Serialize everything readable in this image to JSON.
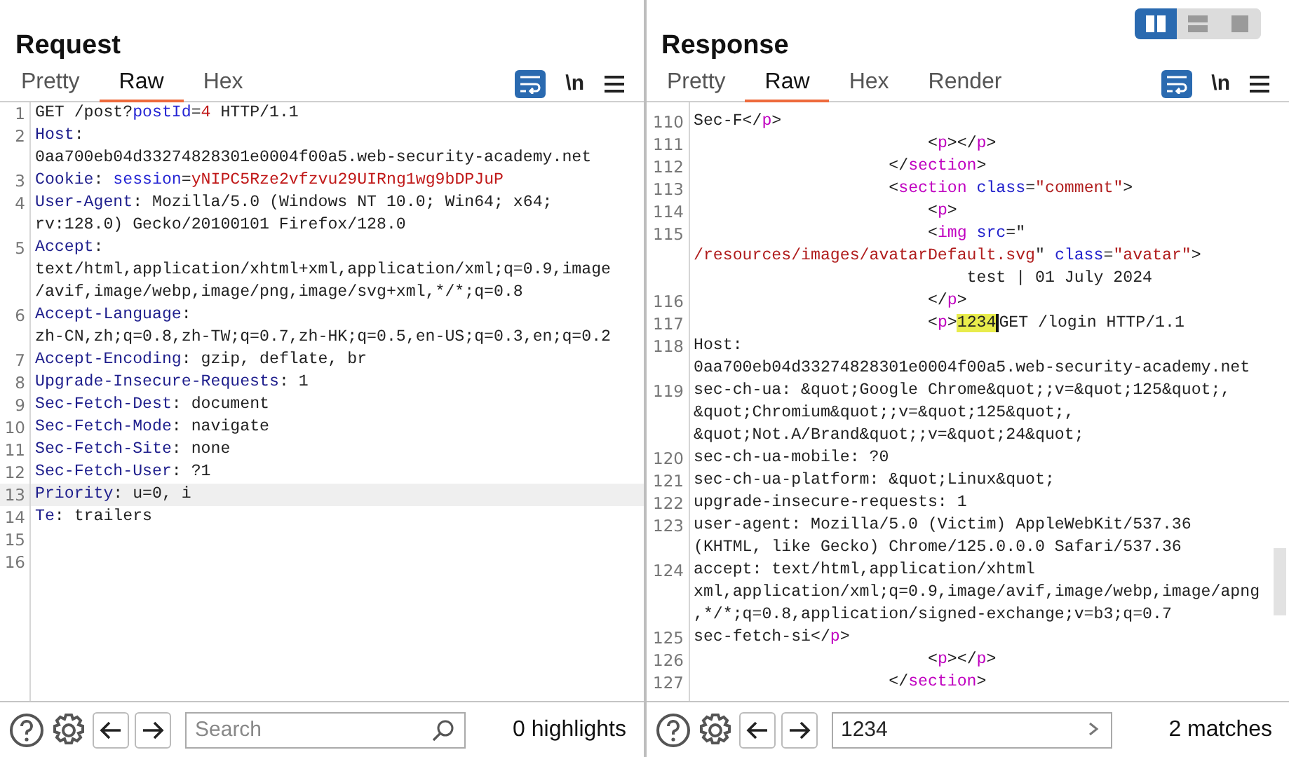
{
  "layout_buttons": [
    {
      "kind": "columns",
      "selected": true
    },
    {
      "kind": "rows",
      "selected": false
    },
    {
      "kind": "single",
      "selected": false
    }
  ],
  "panes": [
    {
      "title": "Request",
      "tabs": [
        {
          "label": "Pretty",
          "selected": false
        },
        {
          "label": "Raw",
          "selected": true
        },
        {
          "label": "Hex",
          "selected": false
        }
      ],
      "wrap_on": true,
      "newline_label": "\\n",
      "rows": [
        {
          "number": "1",
          "current": false,
          "segments": [
            {
              "kind": "plain",
              "text": "GET /post?"
            },
            {
              "kind": "param",
              "text": "postId"
            },
            {
              "kind": "plain",
              "text": "="
            },
            {
              "kind": "value",
              "text": "4"
            },
            {
              "kind": "plain",
              "text": " HTTP/1.1"
            }
          ]
        },
        {
          "number": "2",
          "current": false,
          "segments": [
            {
              "kind": "name",
              "text": "Host"
            },
            {
              "kind": "plain",
              "text": ":"
            }
          ]
        },
        {
          "current": false,
          "segments": [
            {
              "kind": "plain",
              "text": "0aa700eb04d33274828301e0004f00a5.web-security-academy.net"
            }
          ]
        },
        {
          "number": "3",
          "current": false,
          "segments": [
            {
              "kind": "name",
              "text": "Cookie"
            },
            {
              "kind": "plain",
              "text": ": "
            },
            {
              "kind": "param",
              "text": "session"
            },
            {
              "kind": "plain",
              "text": "="
            },
            {
              "kind": "value",
              "text": "yNIPC5Rze2vfzvu29UIRng1wg9bDPJuP"
            }
          ]
        },
        {
          "number": "4",
          "current": false,
          "segments": [
            {
              "kind": "name",
              "text": "User-Agent"
            },
            {
              "kind": "plain",
              "text": ": Mozilla/5.0 (Windows NT 10.0; Win64; x64;"
            }
          ]
        },
        {
          "current": false,
          "segments": [
            {
              "kind": "plain",
              "text": "rv:128.0) Gecko/20100101 Firefox/128.0"
            }
          ]
        },
        {
          "number": "5",
          "current": false,
          "segments": [
            {
              "kind": "name",
              "text": "Accept"
            },
            {
              "kind": "plain",
              "text": ":"
            }
          ]
        },
        {
          "current": false,
          "segments": [
            {
              "kind": "plain",
              "text": "text/html,application/xhtml+xml,application/xml;q=0.9,image"
            }
          ]
        },
        {
          "current": false,
          "segments": [
            {
              "kind": "plain",
              "text": "/avif,image/webp,image/png,image/svg+xml,*/*;q=0.8"
            }
          ]
        },
        {
          "number": "6",
          "current": false,
          "segments": [
            {
              "kind": "name",
              "text": "Accept-Language"
            },
            {
              "kind": "plain",
              "text": ":"
            }
          ]
        },
        {
          "current": false,
          "segments": [
            {
              "kind": "plain",
              "text": "zh-CN,zh;q=0.8,zh-TW;q=0.7,zh-HK;q=0.5,en-US;q=0.3,en;q=0.2"
            }
          ]
        },
        {
          "number": "7",
          "current": false,
          "segments": [
            {
              "kind": "name",
              "text": "Accept-Encoding"
            },
            {
              "kind": "plain",
              "text": ": gzip, deflate, br"
            }
          ]
        },
        {
          "number": "8",
          "current": false,
          "segments": [
            {
              "kind": "name",
              "text": "Upgrade-Insecure-Requests"
            },
            {
              "kind": "plain",
              "text": ": 1"
            }
          ]
        },
        {
          "number": "9",
          "current": false,
          "segments": [
            {
              "kind": "name",
              "text": "Sec-Fetch-Dest"
            },
            {
              "kind": "plain",
              "text": ": document"
            }
          ]
        },
        {
          "number": "10",
          "current": false,
          "segments": [
            {
              "kind": "name",
              "text": "Sec-Fetch-Mode"
            },
            {
              "kind": "plain",
              "text": ": navigate"
            }
          ]
        },
        {
          "number": "11",
          "current": false,
          "segments": [
            {
              "kind": "name",
              "text": "Sec-Fetch-Site"
            },
            {
              "kind": "plain",
              "text": ": none"
            }
          ]
        },
        {
          "number": "12",
          "current": false,
          "segments": [
            {
              "kind": "name",
              "text": "Sec-Fetch-User"
            },
            {
              "kind": "plain",
              "text": ": ?1"
            }
          ]
        },
        {
          "number": "13",
          "current": true,
          "segments": [
            {
              "kind": "name",
              "text": "Priority"
            },
            {
              "kind": "plain",
              "text": ": u=0, i"
            }
          ]
        },
        {
          "number": "14",
          "current": false,
          "segments": [
            {
              "kind": "name",
              "text": "Te"
            },
            {
              "kind": "plain",
              "text": ": trailers"
            }
          ]
        },
        {
          "number": "15",
          "current": false
        },
        {
          "number": "16",
          "current": false
        }
      ],
      "search": {
        "placeholder": "Search"
      },
      "status": "0 highlights"
    },
    {
      "title": "Response",
      "tabs": [
        {
          "label": "Pretty",
          "selected": false
        },
        {
          "label": "Raw",
          "selected": true
        },
        {
          "label": "Hex",
          "selected": false
        },
        {
          "label": "Render",
          "selected": false
        }
      ],
      "wrap_on": true,
      "newline_label": "\\n",
      "rows": [
        {
          "number": "110",
          "current": false,
          "segments": [
            {
              "kind": "plain",
              "text": "Sec-F</"
            },
            {
              "kind": "tag",
              "text": "p"
            },
            {
              "kind": "plain",
              "text": ">"
            }
          ]
        },
        {
          "number": "111",
          "current": false,
          "segments": [
            {
              "kind": "plain",
              "text": "                        <"
            },
            {
              "kind": "tag",
              "text": "p"
            },
            {
              "kind": "plain",
              "text": "></"
            },
            {
              "kind": "tag",
              "text": "p"
            },
            {
              "kind": "plain",
              "text": ">"
            }
          ]
        },
        {
          "number": "112",
          "current": false,
          "segments": [
            {
              "kind": "plain",
              "text": "                    </"
            },
            {
              "kind": "tag",
              "text": "section"
            },
            {
              "kind": "plain",
              "text": ">"
            }
          ]
        },
        {
          "number": "113",
          "current": false,
          "segments": [
            {
              "kind": "plain",
              "text": "                    <"
            },
            {
              "kind": "tag",
              "text": "section"
            },
            {
              "kind": "attr",
              "text": " class"
            },
            {
              "kind": "plain",
              "text": "="
            },
            {
              "kind": "string",
              "text": "\"comment\""
            },
            {
              "kind": "plain",
              "text": ">"
            }
          ]
        },
        {
          "number": "114",
          "current": false,
          "segments": [
            {
              "kind": "plain",
              "text": "                        <"
            },
            {
              "kind": "tag",
              "text": "p"
            },
            {
              "kind": "plain",
              "text": ">"
            }
          ]
        },
        {
          "number": "115",
          "current": false,
          "segments": [
            {
              "kind": "plain",
              "text": "                        <"
            },
            {
              "kind": "tag",
              "text": "img"
            },
            {
              "kind": "attr",
              "text": " src"
            },
            {
              "kind": "plain",
              "text": "=\""
            }
          ]
        },
        {
          "current": false,
          "segments": [
            {
              "kind": "string",
              "text": "/resources/images/avatarDefault.svg"
            },
            {
              "kind": "plain",
              "text": "\" "
            },
            {
              "kind": "attr",
              "text": "class"
            },
            {
              "kind": "plain",
              "text": "="
            },
            {
              "kind": "string",
              "text": "\"avatar\""
            },
            {
              "kind": "plain",
              "text": ">"
            }
          ]
        },
        {
          "current": false,
          "segments": [
            {
              "kind": "plain",
              "text": "                            test | 01 July 2024"
            }
          ]
        },
        {
          "number": "116",
          "current": false,
          "segments": [
            {
              "kind": "plain",
              "text": "                        </"
            },
            {
              "kind": "tag",
              "text": "p"
            },
            {
              "kind": "plain",
              "text": ">"
            }
          ]
        },
        {
          "number": "117",
          "current": false,
          "segments": [
            {
              "kind": "plain",
              "text": "                        <"
            },
            {
              "kind": "tag",
              "text": "p"
            },
            {
              "kind": "plain",
              "text": ">"
            },
            {
              "kind": "match",
              "text": "1234"
            },
            {
              "kind": "plain",
              "text": "GET /login HTTP/1.1"
            }
          ]
        },
        {
          "number": "118",
          "current": false,
          "segments": [
            {
              "kind": "plain",
              "text": "Host:"
            }
          ]
        },
        {
          "current": false,
          "segments": [
            {
              "kind": "plain",
              "text": "0aa700eb04d33274828301e0004f00a5.web-security-academy.net"
            }
          ]
        },
        {
          "number": "119",
          "current": false,
          "segments": [
            {
              "kind": "plain",
              "text": "sec-ch-ua: &quot;Google Chrome&quot;;v=&quot;125&quot;,"
            }
          ]
        },
        {
          "current": false,
          "segments": [
            {
              "kind": "plain",
              "text": "&quot;Chromium&quot;;v=&quot;125&quot;,"
            }
          ]
        },
        {
          "current": false,
          "segments": [
            {
              "kind": "plain",
              "text": "&quot;Not.A/Brand&quot;;v=&quot;24&quot;"
            }
          ]
        },
        {
          "number": "120",
          "current": false,
          "segments": [
            {
              "kind": "plain",
              "text": "sec-ch-ua-mobile: ?0"
            }
          ]
        },
        {
          "number": "121",
          "current": false,
          "segments": [
            {
              "kind": "plain",
              "text": "sec-ch-ua-platform: &quot;Linux&quot;"
            }
          ]
        },
        {
          "number": "122",
          "current": false,
          "segments": [
            {
              "kind": "plain",
              "text": "upgrade-insecure-requests: 1"
            }
          ]
        },
        {
          "number": "123",
          "current": false,
          "segments": [
            {
              "kind": "plain",
              "text": "user-agent: Mozilla/5.0 (Victim) AppleWebKit/537.36"
            }
          ]
        },
        {
          "current": false,
          "segments": [
            {
              "kind": "plain",
              "text": "(KHTML, like Gecko) Chrome/125.0.0.0 Safari/537.36"
            }
          ]
        },
        {
          "number": "124",
          "current": false,
          "segments": [
            {
              "kind": "plain",
              "text": "accept: text/html,application/xhtml"
            }
          ]
        },
        {
          "current": false,
          "segments": [
            {
              "kind": "plain",
              "text": "xml,application/xml;q=0.9,image/avif,image/webp,image/apng"
            }
          ]
        },
        {
          "current": false,
          "segments": [
            {
              "kind": "plain",
              "text": ",*/*;q=0.8,application/signed-exchange;v=b3;q=0.7"
            }
          ]
        },
        {
          "number": "125",
          "current": false,
          "segments": [
            {
              "kind": "plain",
              "text": "sec-fetch-si</"
            },
            {
              "kind": "tag",
              "text": "p"
            },
            {
              "kind": "plain",
              "text": ">"
            }
          ]
        },
        {
          "number": "126",
          "current": false,
          "segments": [
            {
              "kind": "plain",
              "text": "                        <"
            },
            {
              "kind": "tag",
              "text": "p"
            },
            {
              "kind": "plain",
              "text": "></"
            },
            {
              "kind": "tag",
              "text": "p"
            },
            {
              "kind": "plain",
              "text": ">"
            }
          ]
        },
        {
          "number": "127",
          "current": false,
          "segments": [
            {
              "kind": "plain",
              "text": "                    </"
            },
            {
              "kind": "tag",
              "text": "section"
            },
            {
              "kind": "plain",
              "text": ">"
            }
          ]
        }
      ],
      "search": {
        "value": "1234"
      },
      "status": "2 matches"
    }
  ]
}
